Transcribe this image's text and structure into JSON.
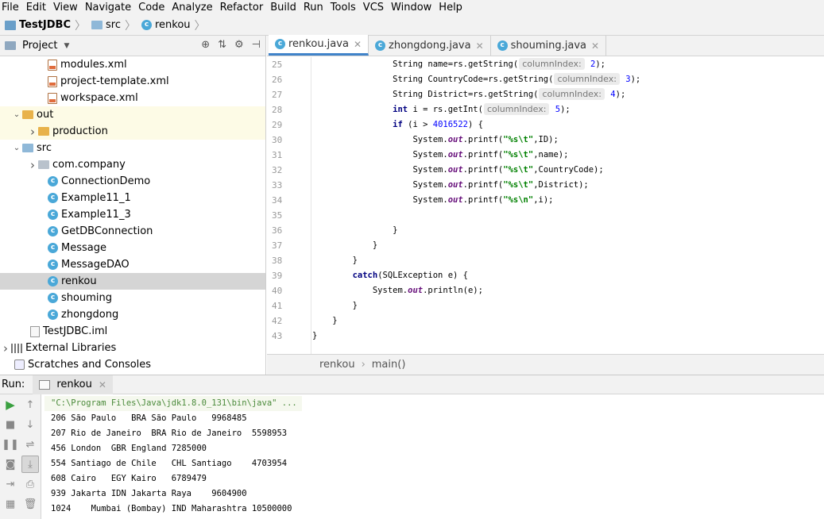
{
  "menu": [
    "File",
    "Edit",
    "View",
    "Navigate",
    "Code",
    "Analyze",
    "Refactor",
    "Build",
    "Run",
    "Tools",
    "VCS",
    "Window",
    "Help"
  ],
  "navbar": {
    "project": "TestJDBC",
    "folder": "src",
    "file": "renkou"
  },
  "project_panel": {
    "title": "Project",
    "items": [
      {
        "label": "modules.xml",
        "icon": "xml-file-icon",
        "indent": 3
      },
      {
        "label": "project-template.xml",
        "icon": "xml-file-icon",
        "indent": 3
      },
      {
        "label": "workspace.xml",
        "icon": "xml-file-icon",
        "indent": 3
      },
      {
        "label": "out",
        "icon": "folder-orange-icon",
        "indent": 1,
        "arrow": "down",
        "highlight": true
      },
      {
        "label": "production",
        "icon": "folder-orange-icon",
        "indent": 2,
        "arrow": "right",
        "highlight": true
      },
      {
        "label": "src",
        "icon": "folder-blue-icon",
        "indent": 1,
        "arrow": "down"
      },
      {
        "label": "com.company",
        "icon": "package-icon",
        "indent": 2,
        "arrow": "right"
      },
      {
        "label": "ConnectionDemo",
        "icon": "class-icon",
        "indent": 3
      },
      {
        "label": "Example11_1",
        "icon": "class-icon",
        "indent": 3
      },
      {
        "label": "Example11_3",
        "icon": "class-icon",
        "indent": 3
      },
      {
        "label": "GetDBConnection",
        "icon": "class-icon",
        "indent": 3
      },
      {
        "label": "Message",
        "icon": "class-icon",
        "indent": 3
      },
      {
        "label": "MessageDAO",
        "icon": "class-icon",
        "indent": 3
      },
      {
        "label": "renkou",
        "icon": "class-icon",
        "indent": 3,
        "selected": true
      },
      {
        "label": "shouming",
        "icon": "class-icon",
        "indent": 3
      },
      {
        "label": "zhongdong",
        "icon": "class-icon",
        "indent": 3
      },
      {
        "label": "TestJDBC.iml",
        "icon": "iml-file-icon",
        "indent": 2
      },
      {
        "label": "External Libraries",
        "icon": "library-icon",
        "indent": 0,
        "arrow": "right"
      },
      {
        "label": "Scratches and Consoles",
        "icon": "scratch-icon",
        "indent": 1
      }
    ]
  },
  "editor": {
    "tabs": [
      {
        "label": "renkou.java",
        "active": true
      },
      {
        "label": "zhongdong.java",
        "active": false
      },
      {
        "label": "shouming.java",
        "active": false
      }
    ],
    "line_numbers": [
      "25",
      "26",
      "27",
      "28",
      "29",
      "30",
      "31",
      "32",
      "33",
      "34",
      "35",
      "36",
      "37",
      "38",
      "39",
      "40",
      "41",
      "42",
      "43"
    ],
    "breadcrumb": {
      "class": "renkou",
      "method": "main()"
    }
  },
  "code": {
    "l25": {
      "a": "String name=rs.getString(",
      "hint": "columnIndex:",
      "n": "2",
      "b": ");"
    },
    "l26": {
      "a": "String CountryCode=rs.getString(",
      "hint": "columnIndex:",
      "n": "3",
      "b": ");"
    },
    "l27": {
      "a": "String District=rs.getString(",
      "hint": "columnIndex:",
      "n": "4",
      "b": ");"
    },
    "l28": {
      "kw": "int",
      "a": " i = rs.getInt(",
      "hint": "columnIndex:",
      "n": "5",
      "b": ");"
    },
    "l29": {
      "kw": "if",
      "a": " (i > ",
      "n": "4016522",
      "b": ") {"
    },
    "l30": {
      "a": "System.",
      "fld": "out",
      "b": ".printf(",
      "str": "\"%s\\t\"",
      "c": ",ID);"
    },
    "l31": {
      "a": "System.",
      "fld": "out",
      "b": ".printf(",
      "str": "\"%s\\t\"",
      "c": ",name);"
    },
    "l32": {
      "a": "System.",
      "fld": "out",
      "b": ".printf(",
      "str": "\"%s\\t\"",
      "c": ",CountryCode);"
    },
    "l33": {
      "a": "System.",
      "fld": "out",
      "b": ".printf(",
      "str": "\"%s\\t\"",
      "c": ",District);"
    },
    "l34": {
      "a": "System.",
      "fld": "out",
      "b": ".printf(",
      "str": "\"%s\\n\"",
      "c": ",i);"
    },
    "l36": {
      "a": "}"
    },
    "l37": {
      "a": "}"
    },
    "l38": {
      "a": "}"
    },
    "l39": {
      "kw": "catch",
      "a": "(SQLException e) {"
    },
    "l40": {
      "a": "System.",
      "fld": "out",
      "b": ".println(e);"
    },
    "l41": {
      "a": "}"
    },
    "l42": {
      "a": "}"
    },
    "l43": {
      "a": "}"
    }
  },
  "run": {
    "label": "Run:",
    "tab": "renkou",
    "console": [
      "\"C:\\Program Files\\Java\\jdk1.8.0_131\\bin\\java\" ...",
      "206 São Paulo   BRA São Paulo   9968485",
      "207 Rio de Janeiro  BRA Rio de Janeiro  5598953",
      "456 London  GBR England 7285000",
      "554 Santiago de Chile   CHL Santiago    4703954",
      "608 Cairo   EGY Kairo   6789479",
      "939 Jakarta IDN Jakarta Raya    9604900",
      "1024    Mumbai (Bombay) IND Maharashtra 10500000"
    ]
  }
}
